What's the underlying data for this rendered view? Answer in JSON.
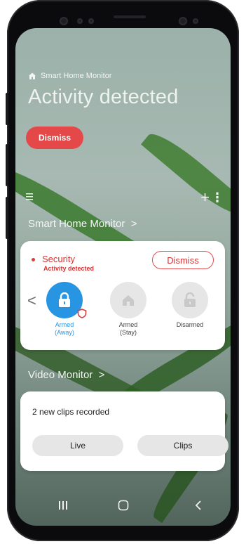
{
  "header": {
    "app_label": "Smart Home Monitor",
    "title": "Activity detected",
    "dismiss_label": "Dismiss"
  },
  "toolbar": {
    "menu_icon": "menu-icon",
    "add_icon": "plus-icon",
    "more_icon": "more-icon"
  },
  "sections": {
    "smart_home_title": "Smart Home Monitor",
    "video_title": "Video Monitor"
  },
  "security_card": {
    "title": "Security",
    "subtitle": "Activity detected",
    "dismiss_label": "Dismiss",
    "modes": [
      {
        "label_line1": "Armed",
        "label_line2": "(Away)",
        "icon": "lock-icon",
        "active": true
      },
      {
        "label_line1": "Armed",
        "label_line2": "(Stay)",
        "icon": "home-icon",
        "active": false
      },
      {
        "label_line1": "Disarmed",
        "label_line2": "",
        "icon": "unlock-icon",
        "active": false
      }
    ]
  },
  "video_card": {
    "status": "2 new clips recorded",
    "live_label": "Live",
    "clips_label": "Clips"
  },
  "nav": {
    "recent": "recent-apps-icon",
    "home": "home-circle-icon",
    "back": "back-icon"
  },
  "colors": {
    "accent_blue": "#2795e2",
    "alert_red": "#e44848"
  }
}
